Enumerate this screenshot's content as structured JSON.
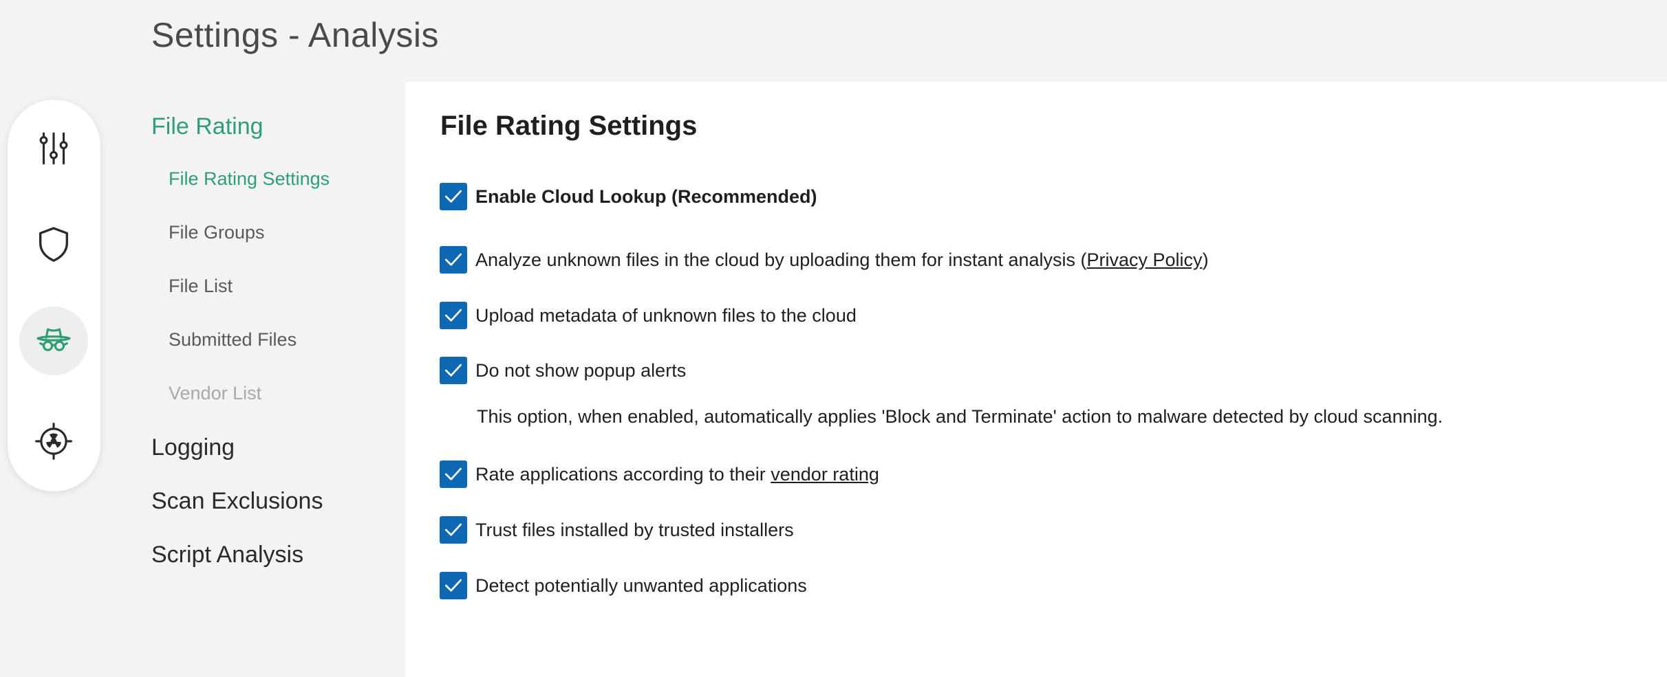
{
  "header": {
    "title": "Settings - Analysis"
  },
  "rail": {
    "items": [
      {
        "icon": "sliders-icon",
        "active": false
      },
      {
        "icon": "shield-icon",
        "active": false
      },
      {
        "icon": "spy-hat-icon",
        "active": true
      },
      {
        "icon": "radiation-target-icon",
        "active": false
      }
    ],
    "accent_color": "#2f9e73"
  },
  "nav": {
    "sections": [
      {
        "label": "File Rating",
        "active": true,
        "items": [
          {
            "label": "File Rating Settings",
            "state": "active"
          },
          {
            "label": "File Groups",
            "state": "normal"
          },
          {
            "label": "File List",
            "state": "normal"
          },
          {
            "label": "Submitted Files",
            "state": "normal"
          },
          {
            "label": "Vendor List",
            "state": "disabled"
          }
        ]
      },
      {
        "label": "Logging",
        "active": false
      },
      {
        "label": "Scan Exclusions",
        "active": false
      },
      {
        "label": "Script Analysis",
        "active": false
      }
    ]
  },
  "main": {
    "title": "File Rating Settings",
    "checkbox_color": "#0f68b3",
    "options": [
      {
        "label": "Enable Cloud Lookup (Recommended)",
        "checked": true
      },
      {
        "label_pre": "Analyze unknown files in the cloud by uploading them for instant analysis (",
        "link": "Privacy Policy",
        "label_post": ")",
        "checked": true
      },
      {
        "label": "Upload metadata of unknown files to the cloud",
        "checked": true
      },
      {
        "label": "Do not show popup alerts",
        "checked": true,
        "note": "This option, when enabled, automatically applies 'Block and Terminate' action to malware detected by cloud scanning."
      },
      {
        "label_pre": "Rate applications according to their ",
        "link": "vendor rating",
        "checked": true
      },
      {
        "label": "Trust files installed by trusted installers",
        "checked": true
      },
      {
        "label": "Detect potentially unwanted applications",
        "checked": true
      }
    ]
  }
}
